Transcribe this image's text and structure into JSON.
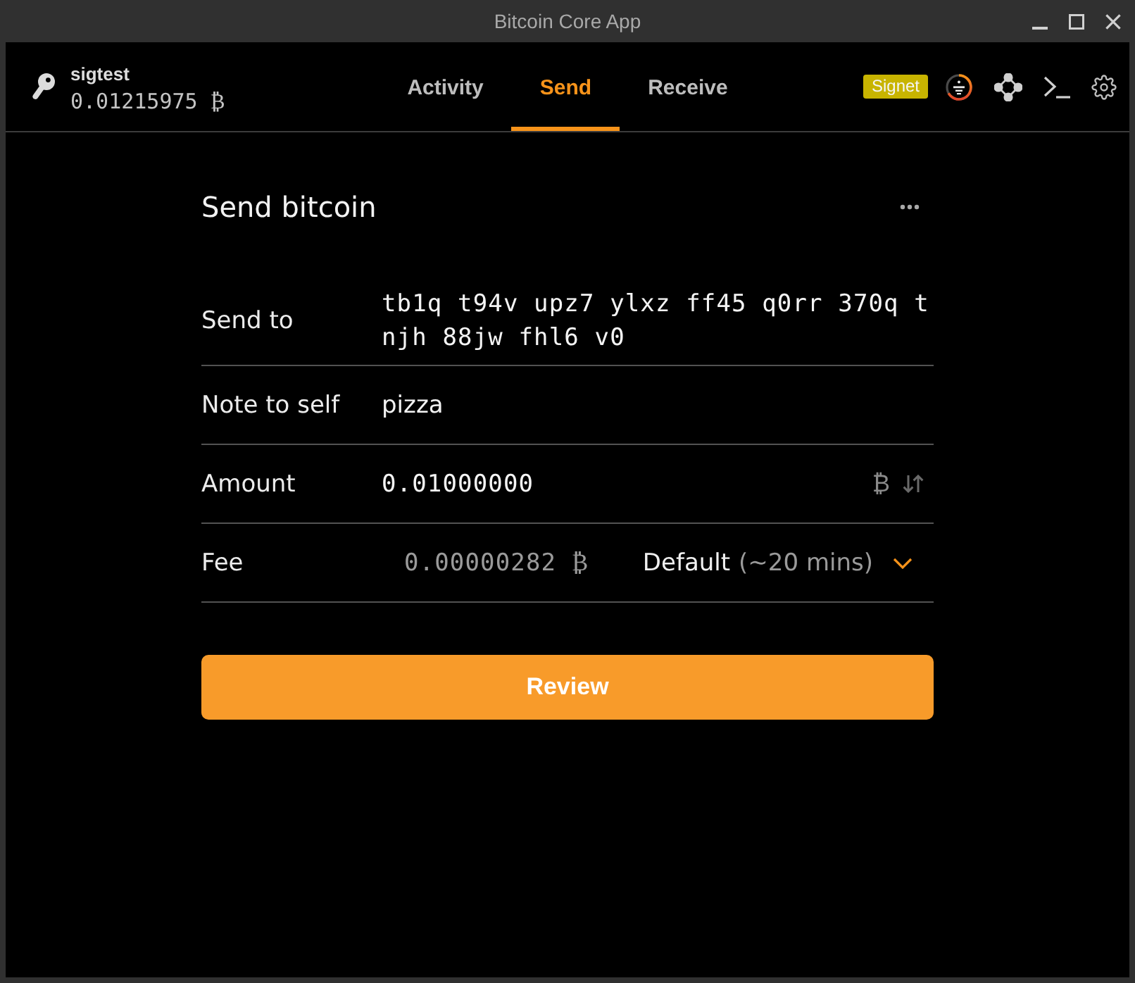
{
  "window": {
    "title": "Bitcoin Core App"
  },
  "wallet": {
    "name": "sigtest",
    "balance": "0.01215975 ₿"
  },
  "tabs": [
    {
      "label": "Activity",
      "selected": false
    },
    {
      "label": "Send",
      "selected": true
    },
    {
      "label": "Receive",
      "selected": false
    }
  ],
  "network_badge": {
    "label": "Signet"
  },
  "form": {
    "title": "Send bitcoin",
    "rows": [
      {
        "kind": "address",
        "label": "Send to",
        "value": "tb1q t94v upz7 ylxz ff45 q0rr 370q tnjh 88jw fhl6 v0"
      },
      {
        "kind": "text",
        "label": "Note to self",
        "value": "pizza"
      },
      {
        "kind": "amount",
        "label": "Amount",
        "value": "0.01000000",
        "unit": "₿"
      },
      {
        "kind": "fee",
        "label": "Fee",
        "value": "0.00000282 ₿",
        "option": "Default",
        "option_detail": "(~20 mins)"
      }
    ]
  },
  "review_button": {
    "label": "Review"
  }
}
